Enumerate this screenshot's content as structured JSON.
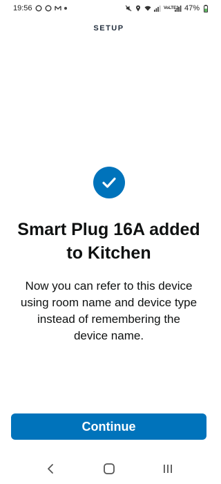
{
  "status_bar": {
    "time": "19:56",
    "network": "VoLTE2",
    "battery": "47%",
    "icons": [
      "circle-icon",
      "circle-icon",
      "gmail-icon",
      "dot-icon",
      "mute-icon",
      "location-icon",
      "wifi-icon",
      "signal-icon",
      "signal-icon",
      "battery-icon"
    ]
  },
  "header": {
    "title": "SETUP"
  },
  "success": {
    "title": "Smart Plug 16A added to Kitchen",
    "message": "Now you can refer to this device using room name and device type instead of remembering the device name.",
    "icon": "checkmark-icon"
  },
  "actions": {
    "continue_label": "Continue"
  },
  "nav": {
    "back": "back-icon",
    "home": "home-icon",
    "recents": "recents-icon"
  },
  "colors": {
    "accent": "#0073bb",
    "text": "#0f1111",
    "header_text": "#232f3e"
  }
}
